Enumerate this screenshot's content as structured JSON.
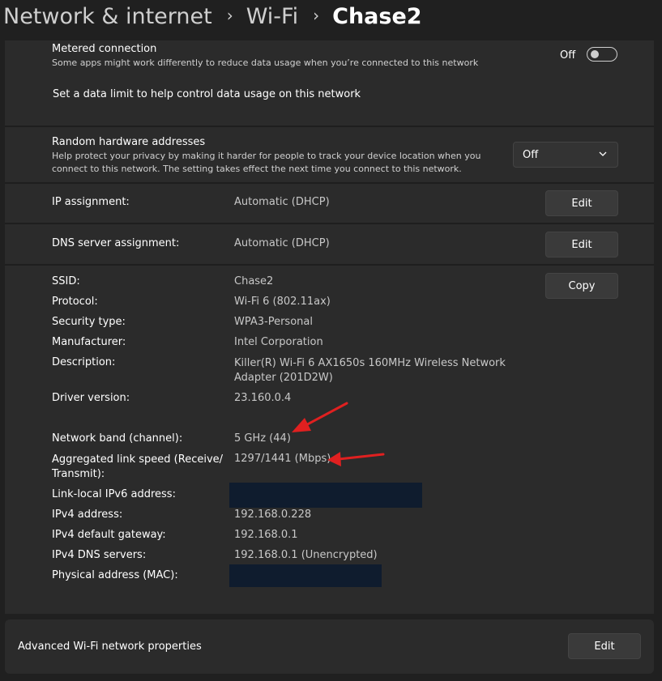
{
  "breadcrumb": {
    "items": [
      "Network & internet",
      "Wi-Fi",
      "Chase2"
    ],
    "separator": "›"
  },
  "metered": {
    "title": "Metered connection",
    "description": "Some apps might work differently to reduce data usage when you’re connected to this network",
    "toggle_state_label": "Off",
    "toggle_on": false,
    "data_limit_link": "Set a data limit to help control data usage on this network"
  },
  "random_hw": {
    "title": "Random hardware addresses",
    "description_line1": "Help protect your privacy by making it harder for people to track your device location when you",
    "description_line2": "connect to this network. The setting takes effect the next time you connect to this network.",
    "dropdown_value": "Off"
  },
  "ip_assignment": {
    "label": "IP assignment:",
    "value": "Automatic (DHCP)",
    "button": "Edit"
  },
  "dns_assignment": {
    "label": "DNS server assignment:",
    "value": "Automatic (DHCP)",
    "button": "Edit"
  },
  "properties": {
    "copy_button": "Copy",
    "ssid": {
      "label": "SSID:",
      "value": "Chase2"
    },
    "protocol": {
      "label": "Protocol:",
      "value": "Wi-Fi 6 (802.11ax)"
    },
    "security": {
      "label": "Security type:",
      "value": "WPA3-Personal"
    },
    "manufacturer": {
      "label": "Manufacturer:",
      "value": "Intel Corporation"
    },
    "description": {
      "label": "Description:",
      "value_line1": "Killer(R) Wi-Fi 6 AX1650s 160MHz Wireless Network",
      "value_line2": "Adapter (201D2W)"
    },
    "driver": {
      "label": "Driver version:",
      "value": "23.160.0.4"
    },
    "band": {
      "label": "Network band (channel):",
      "value": "5 GHz (44)"
    },
    "link_speed": {
      "label_line1": "Aggregated link speed (Receive/",
      "label_line2": "Transmit):",
      "value": "1297/1441 (Mbps)"
    },
    "ipv6": {
      "label": "Link-local IPv6 address:",
      "value_redacted": true
    },
    "ipv4": {
      "label": "IPv4 address:",
      "value": "192.168.0.228"
    },
    "gateway": {
      "label": "IPv4 default gateway:",
      "value": "192.168.0.1"
    },
    "dns": {
      "label": "IPv4 DNS servers:",
      "value": "192.168.0.1 (Unencrypted)"
    },
    "mac": {
      "label": "Physical address (MAC):",
      "value_redacted": true
    }
  },
  "advanced": {
    "title": "Advanced Wi-Fi network properties",
    "button": "Edit"
  },
  "colors": {
    "background": "#202020",
    "card": "#2b2b2b",
    "annotation_arrow": "#e02020",
    "redaction": "#0f1c2e"
  }
}
